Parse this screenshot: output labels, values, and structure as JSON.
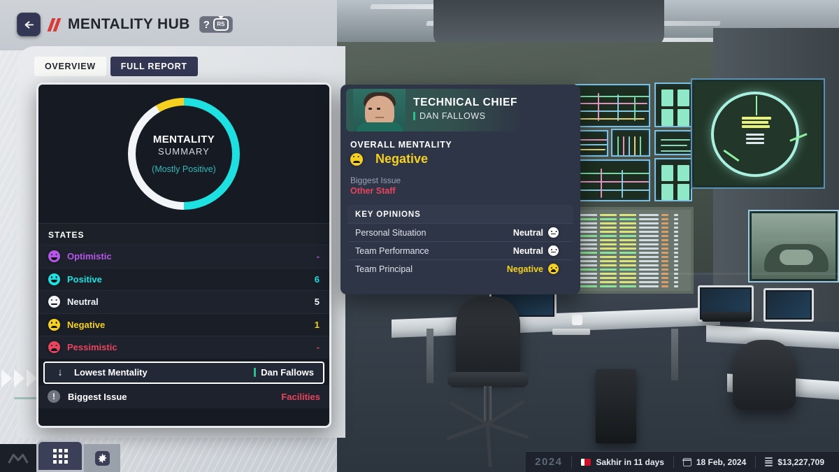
{
  "header": {
    "back_icon": "arrow-left-icon",
    "title": "MENTALITY HUB",
    "help_icon": "question-mark-icon",
    "stick_hint": "RS"
  },
  "tabs": [
    {
      "label": "OVERVIEW",
      "active": true
    },
    {
      "label": "FULL REPORT",
      "active": false
    }
  ],
  "overview": {
    "donut": {
      "title": "MENTALITY",
      "subtitle": "SUMMARY",
      "verdict": "(Mostly Positive)"
    },
    "states_header": "STATES",
    "states": [
      {
        "label": "Optimistic",
        "value": "-",
        "color": "#b557e8",
        "mood": "smile"
      },
      {
        "label": "Positive",
        "value": "6",
        "color": "#1fe0e0",
        "mood": "smile"
      },
      {
        "label": "Neutral",
        "value": "5",
        "color": "#f2f4f7",
        "mood": "flat"
      },
      {
        "label": "Negative",
        "value": "1",
        "color": "#f5d020",
        "mood": "frown"
      },
      {
        "label": "Pessimistic",
        "value": "-",
        "color": "#e8445e",
        "mood": "frown"
      }
    ],
    "lowest_mentality": {
      "icon": "arrow-down-icon",
      "label": "Lowest Mentality",
      "value": "Dan Fallows"
    },
    "biggest_issue": {
      "icon": "exclamation-icon",
      "label": "Biggest Issue",
      "value": "Facilities",
      "color": "#e8445e"
    }
  },
  "detail": {
    "role": "TECHNICAL CHIEF",
    "person": "DAN FALLOWS",
    "overall_label": "OVERALL MENTALITY",
    "overall_value": "Negative",
    "overall_color": "#f5d020",
    "biggest_issue_label": "Biggest Issue",
    "biggest_issue_value": "Other Staff",
    "key_opinions_header": "KEY OPINIONS",
    "opinions": [
      {
        "name": "Personal Situation",
        "value": "Neutral",
        "color": "#ffffff",
        "mood": "flat"
      },
      {
        "name": "Team Performance",
        "value": "Neutral",
        "color": "#ffffff",
        "mood": "flat"
      },
      {
        "name": "Team Principal",
        "value": "Negative",
        "color": "#f5d020",
        "mood": "frown"
      }
    ]
  },
  "bottom": {
    "logo": "m-logo-icon",
    "menu_icon": "grid-menu-icon",
    "settings_icon": "gear-icon"
  },
  "status": {
    "year": "2024",
    "next_race": "Sakhir in 11 days",
    "date": "18 Feb, 2024",
    "money": "$13,227,709"
  },
  "chart_data": {
    "type": "pie",
    "title": "MENTALITY SUMMARY",
    "categories": [
      "Positive",
      "Neutral",
      "Negative"
    ],
    "values": [
      6,
      5,
      1
    ],
    "colors": [
      "#1fe0e0",
      "#f2f4f7",
      "#f5d020"
    ],
    "total": 12,
    "annotation": "(Mostly Positive)",
    "legend": "states-list"
  }
}
